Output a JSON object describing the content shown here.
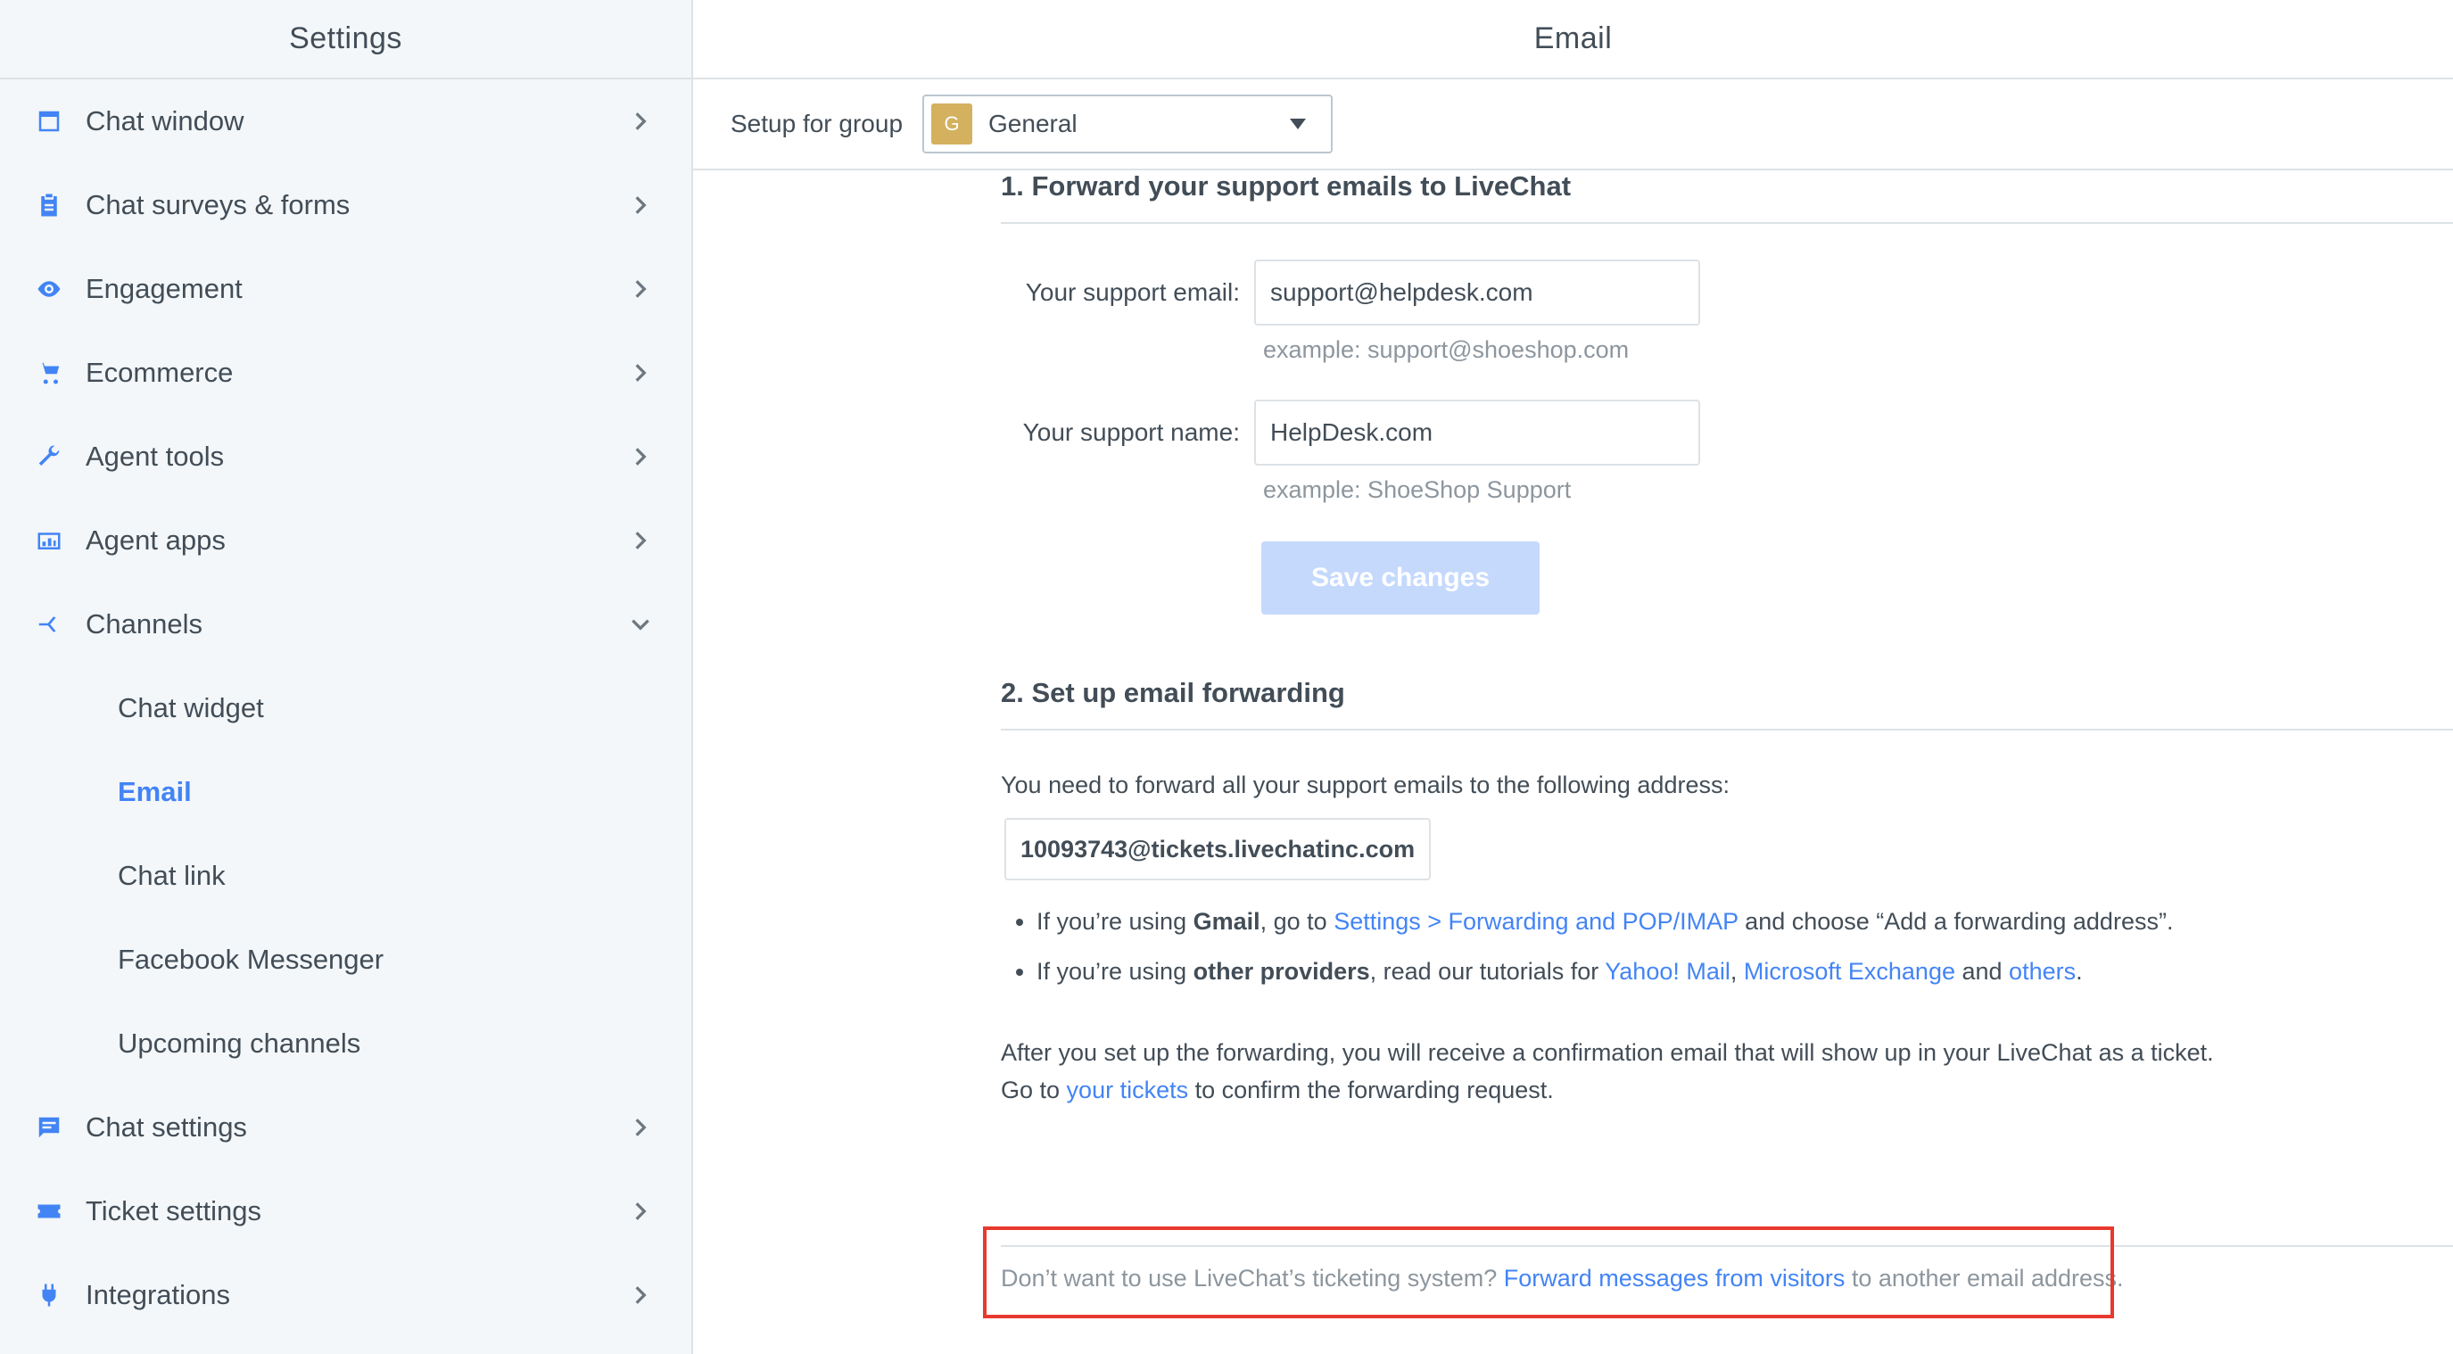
{
  "sidebar": {
    "title": "Settings",
    "items": [
      {
        "label": "Chat window",
        "icon": "window-icon"
      },
      {
        "label": "Chat surveys & forms",
        "icon": "clipboard-icon"
      },
      {
        "label": "Engagement",
        "icon": "eye-icon"
      },
      {
        "label": "Ecommerce",
        "icon": "cart-icon"
      },
      {
        "label": "Agent tools",
        "icon": "wrench-icon"
      },
      {
        "label": "Agent apps",
        "icon": "apps-icon"
      },
      {
        "label": "Channels",
        "icon": "channels-icon"
      }
    ],
    "channels_sub": [
      "Chat widget",
      "Email",
      "Chat link",
      "Facebook Messenger",
      "Upcoming channels"
    ],
    "active_sub": "Email",
    "items_after": [
      {
        "label": "Chat settings",
        "icon": "chat-bubble-icon"
      },
      {
        "label": "Ticket settings",
        "icon": "ticket-icon"
      },
      {
        "label": "Integrations",
        "icon": "plug-icon"
      }
    ]
  },
  "main": {
    "title": "Email",
    "group_label": "Setup for group",
    "group_badge": "G",
    "group_value": "General",
    "section1_title": "1. Forward your support emails to LiveChat",
    "support_email_label": "Your support email:",
    "support_email_value": "support@helpdesk.com",
    "support_email_hint": "example: support@shoeshop.com",
    "support_name_label": "Your support name:",
    "support_name_value": "HelpDesk.com",
    "support_name_hint": "example: ShoeShop Support",
    "save_label": "Save changes",
    "section2_title": "2. Set up email forwarding",
    "forward_intro": "You need to forward all your support emails to the following address:",
    "forward_address": "10093743@tickets.livechatinc.com",
    "bullet1": {
      "pre": "If you’re using ",
      "bold": "Gmail",
      "mid": ", go to ",
      "link": "Settings > Forwarding and POP/IMAP",
      "post": " and choose “Add a forwarding address”."
    },
    "bullet2": {
      "pre": "If you’re using ",
      "bold": "other providers",
      "mid": ", read our tutorials for ",
      "link1": "Yahoo! Mail",
      "sep1": ", ",
      "link2": "Microsoft Exchange",
      "sep2": " and ",
      "link3": "others",
      "post": "."
    },
    "after1": "After you set up the forwarding, you will receive a confirmation email that will show up in your LiveChat as a ticket.",
    "after2_pre": "Go to ",
    "after2_link": "your tickets",
    "after2_post": " to confirm the forwarding request.",
    "footer_pre": "Don’t want to use LiveChat’s ticketing system? ",
    "footer_link": "Forward messages from visitors",
    "footer_post": " to another email address."
  },
  "colors": {
    "accent": "#4384f5",
    "highlight": "#e8392e",
    "badge": "#d4b15f"
  }
}
